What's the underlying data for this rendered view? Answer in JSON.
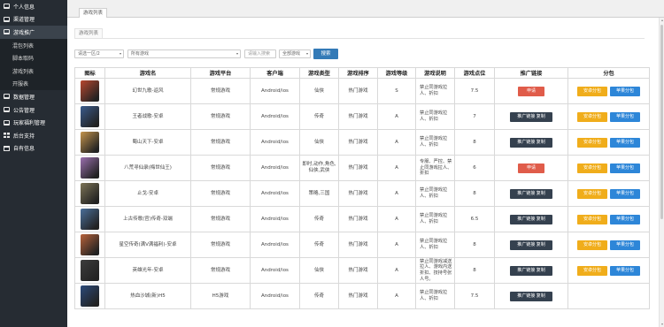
{
  "sidebar": {
    "items": [
      {
        "label": "个人信息",
        "icon": "monitor-icon"
      },
      {
        "label": "渠道管理",
        "icon": "monitor-icon"
      },
      {
        "label": "游戏推广",
        "icon": "monitor-icon",
        "expanded": true,
        "children": [
          {
            "label": "混包列表"
          },
          {
            "label": "脚本取码"
          },
          {
            "label": "游戏列表"
          },
          {
            "label": "开服表"
          }
        ]
      },
      {
        "label": "数据管理",
        "icon": "monitor-icon"
      },
      {
        "label": "公告管理",
        "icon": "monitor-icon"
      },
      {
        "label": "玩家福利管理",
        "icon": "monitor-icon"
      },
      {
        "label": "后台支持",
        "icon": "grid-icon"
      },
      {
        "label": "自有信息",
        "icon": "calendar-icon"
      }
    ]
  },
  "topbar": {
    "tab": "游戏列表"
  },
  "page": {
    "subtab": "游戏列表"
  },
  "filters": {
    "select1": "请选一区/2",
    "select2": "所有游戏",
    "input1_placeholder": "请输入搜索",
    "select3": "全部游戏",
    "search_label": "搜索"
  },
  "table": {
    "headers": [
      "图标",
      "游戏名",
      "游戏平台",
      "客户端",
      "游戏类型",
      "游戏排序",
      "游戏等级",
      "游戏说明",
      "游戏点位",
      "推广链接",
      "分包"
    ],
    "rows": [
      {
        "name": "幻世九歌-返风",
        "platform": "常规游戏",
        "client": "Android/ios",
        "type": "仙侠",
        "sort": "热门游戏",
        "level": "S",
        "desc": "禁止同游戏拉人、折扣",
        "points": "7.5",
        "link": "申请",
        "pack": true,
        "icon_color": "#b8472f"
      },
      {
        "name": "王者战歌-安卓",
        "platform": "常规游戏",
        "client": "Android/ios",
        "type": "传奇",
        "sort": "热门游戏",
        "level": "A",
        "desc": "禁止同游戏拉人、折扣",
        "points": "7",
        "link": "推广链接 复制",
        "pack": true,
        "icon_color": "#3b5b8c"
      },
      {
        "name": "蜀山天下-安卓",
        "platform": "常规游戏",
        "client": "Android/ios",
        "type": "仙侠",
        "sort": "热门游戏",
        "level": "A",
        "desc": "禁止同游戏拉人、折扣",
        "points": "8",
        "link": "推广链接 复制",
        "pack": true,
        "icon_color": "#c4944c"
      },
      {
        "name": "八荒寻仙录(梅世仙王)",
        "platform": "常规游戏",
        "client": "Android/ios",
        "type": "即时,动作,角色,仙侠,武侠",
        "sort": "热门游戏",
        "level": "A",
        "desc": "专服、严控、禁止同游戏拉人、折扣",
        "points": "6",
        "link": "申请",
        "pack": true,
        "icon_color": "#9a6fae"
      },
      {
        "name": "止戈-安卓",
        "platform": "常规游戏",
        "client": "Android/ios",
        "type": "策略,三国",
        "sort": "热门游戏",
        "level": "A",
        "desc": "禁止同游戏拉人、折扣",
        "points": "8",
        "link": "推广链接 复制",
        "pack": true,
        "icon_color": "#7d7456"
      },
      {
        "name": "上古传歌(官)传奇-双端",
        "platform": "常规游戏",
        "client": "Android/ios",
        "type": "传奇",
        "sort": "热门游戏",
        "level": "A",
        "desc": "禁止同游戏拉人、折扣",
        "points": "6.5",
        "link": "推广链接 复制",
        "pack": true,
        "icon_color": "#4a6f9a"
      },
      {
        "name": "星空传奇(满V满福利)-安卓",
        "platform": "常规游戏",
        "client": "Android/ios",
        "type": "传奇",
        "sort": "热门游戏",
        "level": "A",
        "desc": "禁止同游戏拉人、折扣",
        "points": "8",
        "link": "推广链接 复制",
        "pack": true,
        "icon_color": "#b8623a"
      },
      {
        "name": "英雄光年-安卓",
        "platform": "常规游戏",
        "client": "Android/ios",
        "type": "仙侠",
        "sort": "热门游戏",
        "level": "A",
        "desc": "禁止同游戏减送拉人、游戏内送折扣、技持号张人号。",
        "points": "8",
        "link": "推广链接 复制",
        "pack": true,
        "icon_color": "#3d3d3d"
      },
      {
        "name": "热血沙城(新)H5",
        "platform": "H5游戏",
        "client": "Android/ios",
        "type": "传奇",
        "sort": "热门游戏",
        "level": "A",
        "desc": "禁止同游戏拉人、折扣",
        "points": "7.5",
        "link": "推广链接 复制",
        "pack": false,
        "icon_color": "#2c4a7a"
      }
    ],
    "pack_labels": {
      "android": "安卓分包",
      "apple": "苹果分包"
    }
  },
  "colors": {
    "sidebar_bg": "#262c33",
    "apply_btn": "#e05c4a",
    "link_btn": "#35414f",
    "android_btn": "#f0ad1b",
    "apple_btn": "#2d86d8",
    "search_btn": "#337ab7"
  }
}
